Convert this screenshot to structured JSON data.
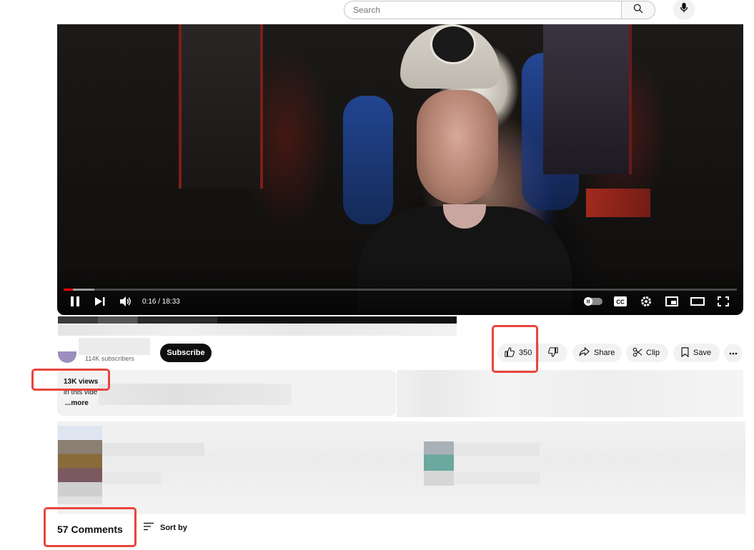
{
  "search": {
    "placeholder": "Search"
  },
  "player": {
    "time_display": "0:16 / 18:33",
    "progress_played_fraction": 0.014,
    "progress_loaded_fraction": 0.046
  },
  "channel": {
    "subscribers": "114K subscribers",
    "subscribe_label": "Subscribe"
  },
  "actions": {
    "like_count": "350",
    "share_label": "Share",
    "clip_label": "Clip",
    "save_label": "Save"
  },
  "description": {
    "views": "13K views",
    "snippet": "in this vide",
    "more_label": "...more"
  },
  "comments": {
    "count_label": "57 Comments",
    "sort_label": "Sort by"
  },
  "colors": {
    "accent": "#ff0000",
    "highlight": "#e8453c",
    "subscribe_bg": "#0f0f0f"
  }
}
